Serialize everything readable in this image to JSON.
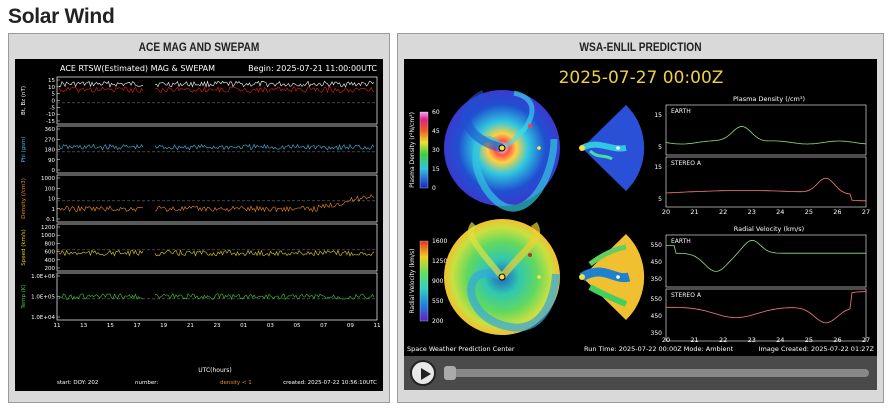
{
  "page": {
    "title": "Solar Wind"
  },
  "ace": {
    "panel_title": "ACE MAG AND SWEPAM",
    "header_left": "ACE RTSW(Estimated) MAG & SWEPAM",
    "header_right": "Begin: 2025-07-21 11:00:00UTC",
    "panels": [
      {
        "label": "Bt, Bz (nT)",
        "ticks": [
          "15",
          "10",
          "5",
          "0",
          "-5",
          "-10",
          "-15"
        ]
      },
      {
        "label": "Phi (gsm)",
        "ticks": [
          "360",
          "270",
          "180",
          "90",
          "0"
        ]
      },
      {
        "label": "Density (/cm3)",
        "ticks": [
          "1000",
          "100",
          "10",
          "1",
          "0.1"
        ]
      },
      {
        "label": "Speed (km/s)",
        "ticks": [
          "1200",
          "1000",
          "800",
          "600",
          "400",
          "200"
        ]
      },
      {
        "label": "Temp (K)",
        "ticks": [
          "1.0E+06",
          "1.0E+05",
          "1.0E+04"
        ]
      }
    ],
    "x_ticks": [
      "11",
      "13",
      "15",
      "17",
      "19",
      "21",
      "23",
      "01",
      "03",
      "05",
      "07",
      "09",
      "11"
    ],
    "x_label": "UTC(hours)",
    "footer_left": "start: DOY: 202",
    "footer_mid": "number:",
    "footer_density": "density < 1",
    "footer_right": "created: 2025-07-22 10:56:10UTC",
    "colors": {
      "bt": "#ffffff",
      "bz": "#e02020",
      "phi": "#3fb8e8",
      "density": "#f08a20",
      "speed": "#e8d020",
      "temp": "#3cc83c"
    }
  },
  "enlil": {
    "panel_title": "WSA-ENLIL PREDICTION",
    "timestamp": "2025-07-27  00:00Z",
    "density_cbar_label": "Plasma Density (r²N/cm³)",
    "density_cbar_ticks": [
      "60",
      "45",
      "30",
      "15",
      "0"
    ],
    "velocity_cbar_label": "Radial Velocity (km/s)",
    "velocity_cbar_ticks": [
      "1600",
      "1250",
      "900",
      "550",
      "200"
    ],
    "plasma_title": "Plasma Density (/cm³)",
    "velocity_title": "Radial Velocity (km/s)",
    "earth_label": "EARTH",
    "stereo_label": "STEREO A",
    "density_ticks_earth": [
      "15",
      "5"
    ],
    "density_ticks_stereo": [
      "15",
      "5"
    ],
    "velocity_ticks_earth": [
      "550",
      "450",
      "350"
    ],
    "velocity_ticks_stereo": [
      "550",
      "450",
      "350"
    ],
    "x_ticks": [
      "20",
      "21",
      "22",
      "23",
      "24",
      "25",
      "26",
      "27"
    ],
    "footer_left": "Space Weather Prediction Center",
    "footer_mid": "Run Time: 2025-07-22 00:00Z  Mode: Ambient",
    "footer_right": "Image Created: 2025-07-22 01:27Z",
    "earth_color": "#8fe07a",
    "stereo_color": "#ff7a7a"
  },
  "player": {
    "play_label": "Play animation",
    "progress": 0.0
  }
}
